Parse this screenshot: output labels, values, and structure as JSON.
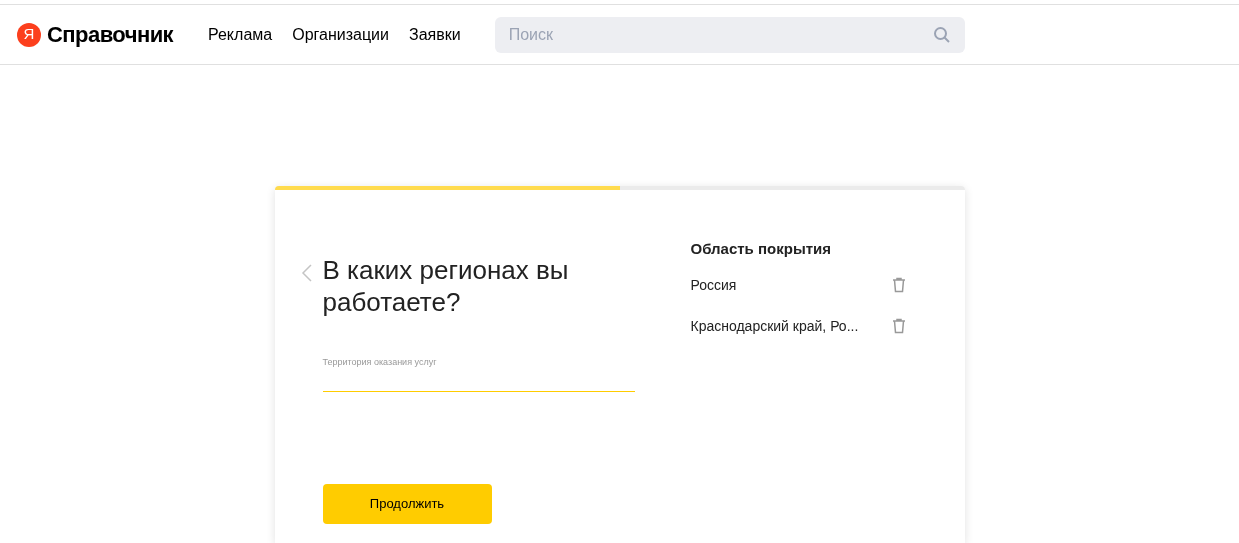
{
  "header": {
    "logo": {
      "letter": "Я",
      "text": "Справочник"
    },
    "nav": [
      "Реклама",
      "Организации",
      "Заявки"
    ],
    "search": {
      "placeholder": "Поиск"
    }
  },
  "wizard": {
    "progress": {
      "level": 0.5
    },
    "title": "В каких регионах вы работаете?",
    "field": {
      "label": "Территория оказания услуг"
    },
    "button": "Продолжить",
    "coverage": {
      "title": "Область покрытия",
      "items": [
        "Россия",
        "Краснодарский край, Ро..."
      ]
    }
  }
}
